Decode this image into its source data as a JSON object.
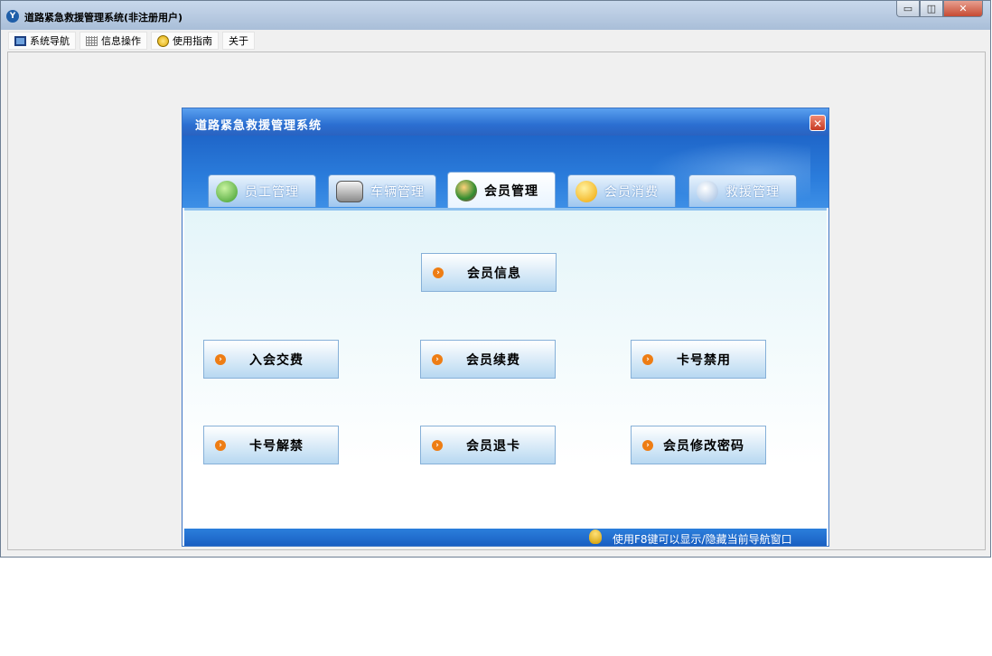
{
  "window": {
    "title": "道路紧急救援管理系统(非注册用户)",
    "icon": "app-logo-icon",
    "controls": {
      "minimize": "▭",
      "restore": "◫",
      "close": "✕"
    }
  },
  "menu": [
    {
      "label": "系统导航",
      "icon": "monitor-icon"
    },
    {
      "label": "信息操作",
      "icon": "grid-icon"
    },
    {
      "label": "使用指南",
      "icon": "help-icon"
    },
    {
      "label": "关于",
      "icon": ""
    }
  ],
  "dialog": {
    "title": "道路紧急救援管理系统",
    "close": "✕",
    "tabs": [
      {
        "label": "员工管理",
        "icon": "staff-icon"
      },
      {
        "label": "车辆管理",
        "icon": "car-icon"
      },
      {
        "label": "会员管理",
        "icon": "member-icon",
        "active": true
      },
      {
        "label": "会员消费",
        "icon": "consume-icon"
      },
      {
        "label": "救援管理",
        "icon": "rescue-icon"
      }
    ],
    "buttons": {
      "member_info": "会员信息",
      "join_fee": "入会交费",
      "renew_fee": "会员续费",
      "card_disable": "卡号禁用",
      "card_enable": "卡号解禁",
      "member_return_card": "会员退卡",
      "change_password": "会员修改密码"
    },
    "status": "使用F8键可以显示/隐藏当前导航窗口"
  },
  "colors": {
    "accent": "#2b6fd1",
    "arrow": "#ee7d14"
  }
}
